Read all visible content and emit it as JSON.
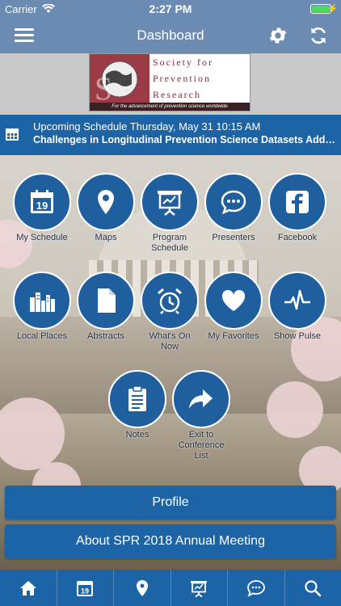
{
  "status_bar": {
    "carrier": "Carrier",
    "time": "2:27 PM"
  },
  "nav": {
    "title": "Dashboard",
    "left_icon": "menu-icon",
    "right_icons": [
      "gear-icon",
      "refresh-icon"
    ]
  },
  "logo": {
    "lines": [
      "Society for",
      "Prevention",
      "Research"
    ],
    "tagline": "For the advancement of prevention science worldwide"
  },
  "banner": {
    "line1": "Upcoming Schedule Thursday, May 31 10:15 AM",
    "line2": "Challenges in Longitudinal Prevention Science Datasets Addr...",
    "icon": "calendar-icon"
  },
  "tiles": [
    {
      "label": "My Schedule",
      "icon": "calendar-icon",
      "calendar_day": "19"
    },
    {
      "label": "Maps",
      "icon": "map-pin-icon"
    },
    {
      "label": "Program Schedule",
      "icon": "presentation-icon"
    },
    {
      "label": "Presenters",
      "icon": "chat-bubble-icon"
    },
    {
      "label": "Facebook",
      "icon": "facebook-icon"
    },
    {
      "label": "Local Places",
      "icon": "city-icon"
    },
    {
      "label": "Abstracts",
      "icon": "document-icon"
    },
    {
      "label": "What's On Now",
      "icon": "alarm-clock-icon"
    },
    {
      "label": "My Favorites",
      "icon": "heart-icon"
    },
    {
      "label": "Show Pulse",
      "icon": "pulse-icon"
    },
    {
      "label": "Notes",
      "icon": "clipboard-icon"
    },
    {
      "label": "Exit to Conference List",
      "icon": "exit-arrow-icon"
    }
  ],
  "buttons": {
    "profile": "Profile",
    "about": "About SPR 2018 Annual Meeting"
  },
  "tab_bar": [
    "home-icon",
    "calendar-icon",
    "map-pin-icon",
    "presentation-icon",
    "chat-bubble-icon",
    "search-icon"
  ],
  "colors": {
    "nav": "#6b8bb3",
    "accent": "#1c64a6",
    "tile": "#1f5f9e",
    "battery": "#4cd964"
  }
}
